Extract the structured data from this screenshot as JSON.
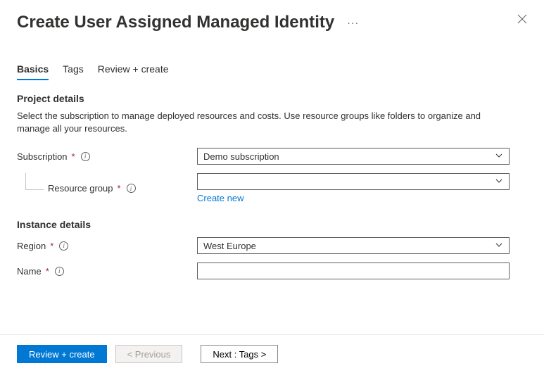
{
  "header": {
    "title": "Create User Assigned Managed Identity"
  },
  "tabs": [
    {
      "label": "Basics",
      "active": true
    },
    {
      "label": "Tags",
      "active": false
    },
    {
      "label": "Review + create",
      "active": false
    }
  ],
  "project_details": {
    "heading": "Project details",
    "description": "Select the subscription to manage deployed resources and costs. Use resource groups like folders to organize and manage all your resources.",
    "subscription": {
      "label": "Subscription",
      "value": "Demo subscription"
    },
    "resource_group": {
      "label": "Resource group",
      "value": "",
      "create_new": "Create new"
    }
  },
  "instance_details": {
    "heading": "Instance details",
    "region": {
      "label": "Region",
      "value": "West Europe"
    },
    "name": {
      "label": "Name",
      "value": ""
    }
  },
  "footer": {
    "review_create": "Review + create",
    "previous": "< Previous",
    "next": "Next : Tags >"
  }
}
